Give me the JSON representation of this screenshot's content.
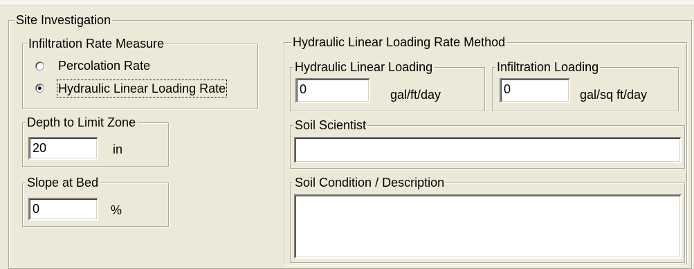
{
  "site_investigation": {
    "title": "Site Investigation",
    "infiltration_rate_measure": {
      "title": "Infiltration Rate Measure",
      "options": [
        "Percolation Rate",
        "Hydraulic Linear Loading Rate"
      ],
      "selected": "Hydraulic Linear Loading Rate"
    },
    "depth_to_limit_zone": {
      "title": "Depth to Limit Zone",
      "value": "20",
      "unit": "in"
    },
    "slope_at_bed": {
      "title": "Slope at Bed",
      "value": "0",
      "unit": "%"
    },
    "hllr_method": {
      "title": "Hydraulic Linear Loading Rate Method",
      "hydraulic_linear_loading": {
        "title": "Hydraulic Linear Loading",
        "value": "0",
        "unit": "gal/ft/day"
      },
      "infiltration_loading": {
        "title": "Infiltration Loading",
        "value": "0",
        "unit": "gal/sq ft/day"
      }
    },
    "soil_scientist": {
      "title": "Soil Scientist",
      "value": ""
    },
    "soil_condition": {
      "title": "Soil Condition / Description",
      "value": ""
    }
  }
}
